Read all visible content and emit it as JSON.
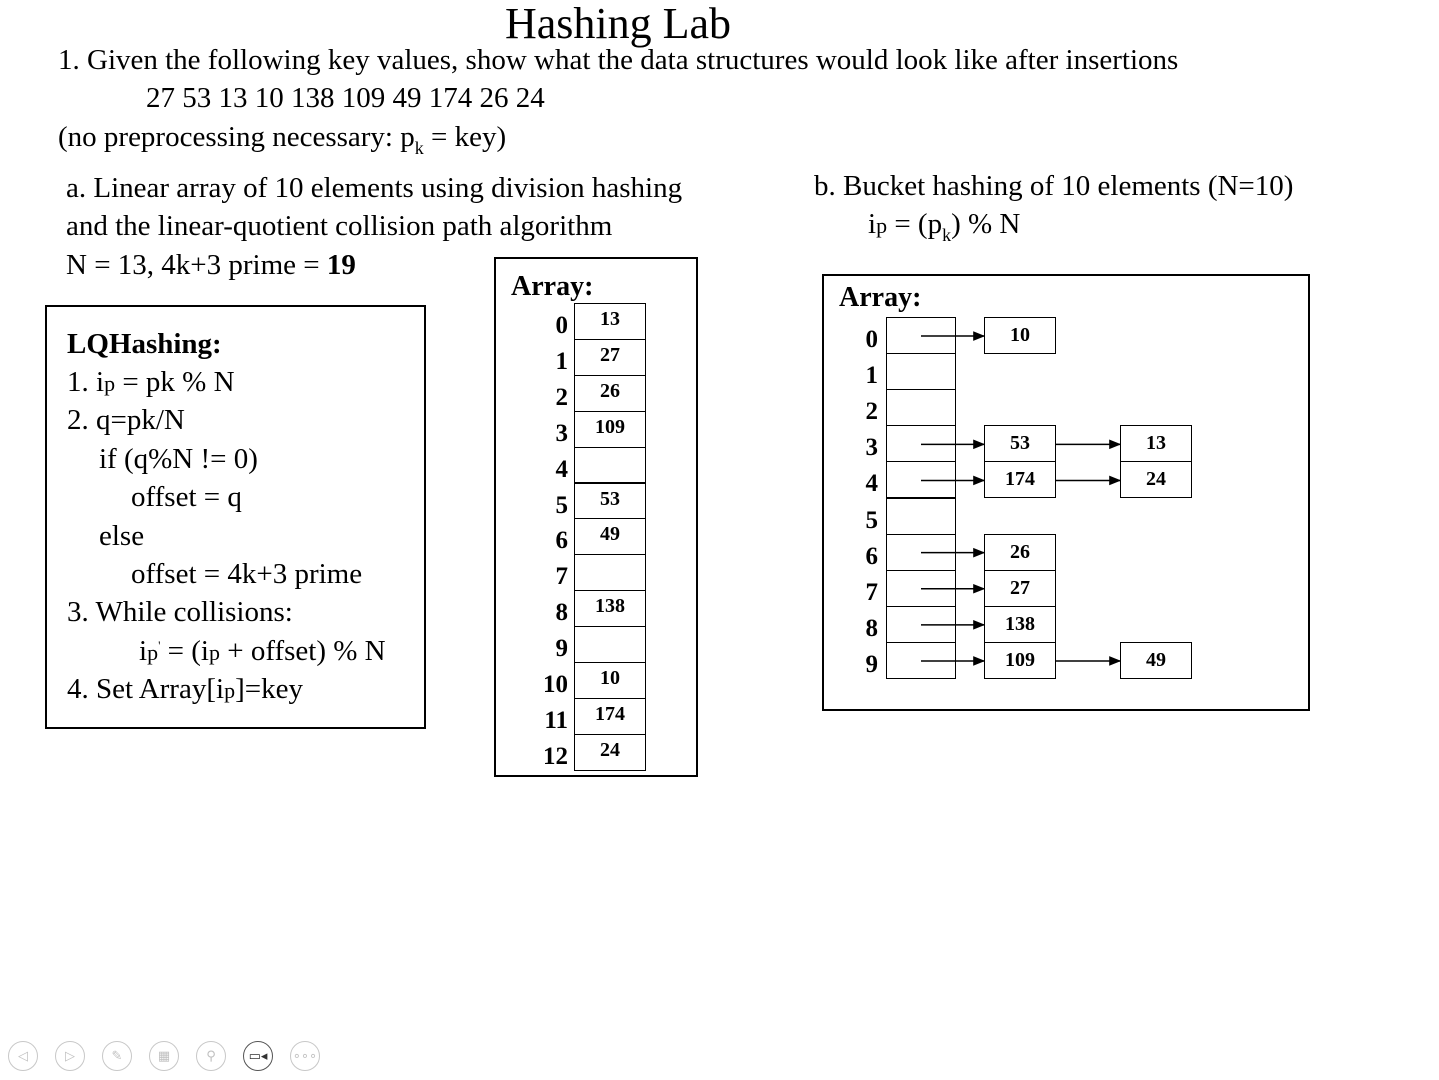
{
  "title": "Hashing Lab",
  "question": {
    "line1": "1.  Given the following key values,  show what the data structures would look like after insertions",
    "keys": "27 53 13 10 138 109 49 174 26 24",
    "note_prefix": "(no preprocessing necessary:  p",
    "note_sub": "k",
    "note_suffix": " = key)"
  },
  "part_a": {
    "line1": "a.    Linear array of 10 elements using division hashing",
    "line2": "and the linear-quotient collision path algorithm",
    "line3_prefix": "N = 13, 4k+3 prime = ",
    "line3_bold": "19"
  },
  "part_b": {
    "line1": "b.    Bucket hashing of 10 elements (N=10)",
    "formula_i": "i",
    "formula_p": "p",
    "formula_mid": " = (p",
    "formula_k": "k",
    "formula_end": ") % N"
  },
  "lq": {
    "title": "LQHashing:",
    "l1a": "1. i",
    "l1b": "p",
    "l1c": " = pk % N",
    "l2": "2. q=pk/N",
    "l3": "if (q%N != 0)",
    "l4": "offset = q",
    "l5": "else",
    "l6": "offset = 4k+3 prime",
    "l7": "3. While collisions:",
    "l8a": "i",
    "l8b": "p",
    "l8c": "'",
    "l8d": " = (i",
    "l8e": "p",
    "l8f": " + offset) % N",
    "l9a": "4. Set Array[i",
    "l9b": "p",
    "l9c": "]=key"
  },
  "array_a": {
    "label": "Array:",
    "indices": [
      "0",
      "1",
      "2",
      "3",
      "4",
      "5",
      "6",
      "7",
      "8",
      "9",
      "10",
      "11",
      "12"
    ],
    "values": [
      "13",
      "27",
      "26",
      "109",
      "",
      "53",
      "49",
      "",
      "138",
      "",
      "10",
      "174",
      "24"
    ]
  },
  "array_b": {
    "label": "Array:",
    "indices": [
      "0",
      "1",
      "2",
      "3",
      "4",
      "5",
      "6",
      "7",
      "8",
      "9"
    ],
    "chains": [
      [
        "10"
      ],
      [],
      [],
      [
        "53",
        "13"
      ],
      [
        "174",
        "24"
      ],
      [],
      [
        "26"
      ],
      [
        "27"
      ],
      [
        "138"
      ],
      [
        "109",
        "49"
      ]
    ]
  },
  "nav": {
    "icons": [
      "back-icon",
      "forward-icon",
      "pen-icon",
      "slides-grid-icon",
      "zoom-icon",
      "video-icon",
      "more-icon"
    ],
    "glyphs": [
      "◁",
      "▷",
      "✎",
      "▦",
      "⚲",
      "▭◂",
      "∘∘∘"
    ]
  }
}
